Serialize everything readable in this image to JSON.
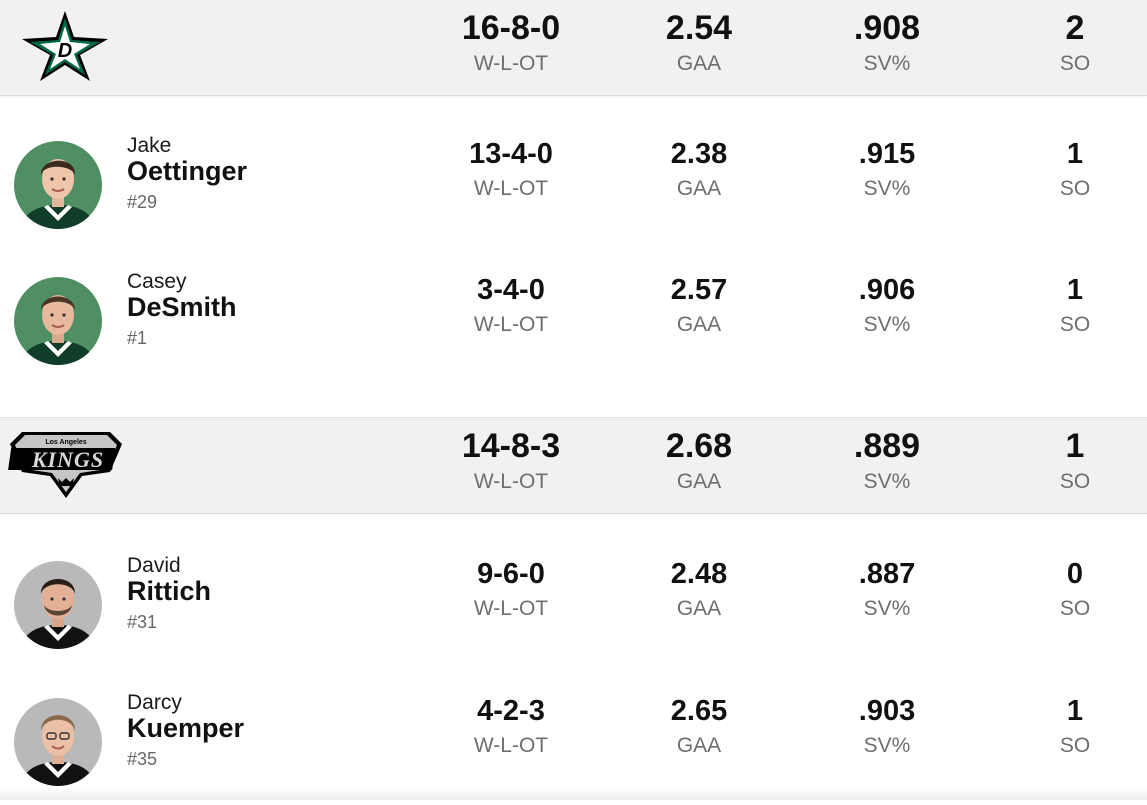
{
  "teams": [
    {
      "logo": "dallas-stars-logo",
      "totals": {
        "record": "16-8-0",
        "gaa": "2.54",
        "sv": ".908",
        "so": "2"
      },
      "goalies": [
        {
          "first": "Jake",
          "last": "Oettinger",
          "number": "#29",
          "record": "13-4-0",
          "gaa": "2.38",
          "sv": ".915",
          "so": "1"
        },
        {
          "first": "Casey",
          "last": "DeSmith",
          "number": "#1",
          "record": "3-4-0",
          "gaa": "2.57",
          "sv": ".906",
          "so": "1"
        }
      ]
    },
    {
      "logo": "los-angeles-kings-logo",
      "logo_text_top": "Los Angeles",
      "logo_text_main": "KINGS",
      "totals": {
        "record": "14-8-3",
        "gaa": "2.68",
        "sv": ".889",
        "so": "1"
      },
      "goalies": [
        {
          "first": "David",
          "last": "Rittich",
          "number": "#31",
          "record": "9-6-0",
          "gaa": "2.48",
          "sv": ".887",
          "so": "0"
        },
        {
          "first": "Darcy",
          "last": "Kuemper",
          "number": "#35",
          "record": "4-2-3",
          "gaa": "2.65",
          "sv": ".903",
          "so": "1"
        }
      ]
    }
  ],
  "labels": {
    "record": "W-L-OT",
    "gaa": "GAA",
    "sv": "SV%",
    "so": "SO"
  },
  "colors": {
    "stars_green": "#006847",
    "stars_jersey_bg": "#4f8f63",
    "kings_jersey_bg": "#b9b9b9",
    "header_bg": "#f1f1f1"
  }
}
